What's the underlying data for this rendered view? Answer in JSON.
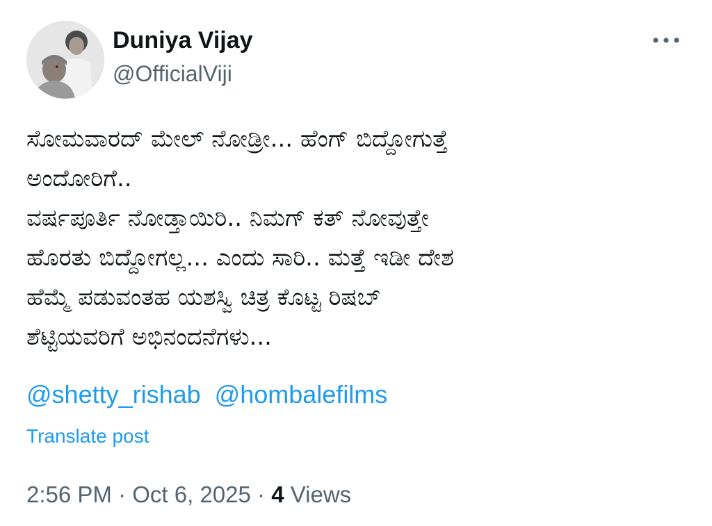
{
  "author": {
    "display_name": "Duniya Vijay",
    "handle": "@OfficialViji"
  },
  "post": {
    "lines": [
      "ಸೋಮವಾರದ್ ಮೇಲ್ ನೋಡ್ರೀ... ಹೆಂಗ್ ಬಿದ್ದೋಗುತ್ತೆ",
      "ಅಂದೋರಿಗೆ..",
      "ವರ್ಷಪೂರ್ತಿ ನೋಡ್ತಾಯಿರಿ.. ನಿಮಗ್ ಕತ್ ನೋವುತ್ತೇ",
      "ಹೊರತು ಬಿದ್ದೋಗಲ್ಲ... ಎಂದು ಸಾರಿ.. ಮತ್ತೆ ಇಡೀ ದೇಶ",
      "ಹೆಮ್ಮೆ ಪಡುವಂತಹ ಯಶಸ್ವಿ ಚಿತ್ರ ಕೊಟ್ಟ  ರಿಷಬ್",
      "ಶೆಟ್ಟಿಯವರಿಗೆ ಅಭಿನಂದನೆಗಳು..."
    ],
    "mentions": [
      "@shetty_rishab",
      "@hombalefilms"
    ],
    "translate_label": "Translate post"
  },
  "meta": {
    "time": "2:56 PM",
    "separator": "·",
    "date": "Oct 6, 2025",
    "views_count": "4",
    "views_label": "Views"
  },
  "icons": {
    "more": "more-horizontal-icon"
  },
  "colors": {
    "link": "#1d9bf0",
    "secondary_text": "#536471",
    "primary_text": "#0f1419"
  }
}
